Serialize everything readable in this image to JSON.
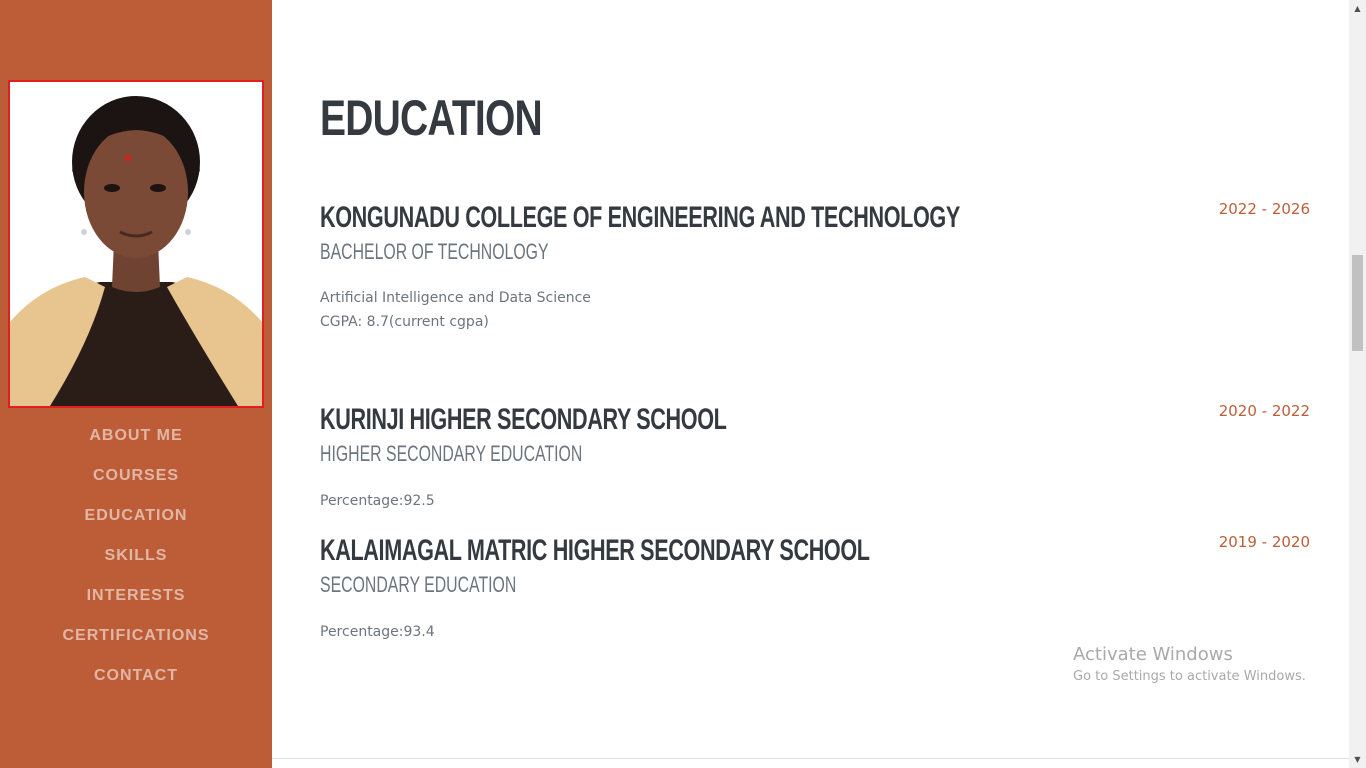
{
  "sidebar": {
    "nav": [
      {
        "label": "ABOUT ME"
      },
      {
        "label": "COURSES"
      },
      {
        "label": "EDUCATION"
      },
      {
        "label": "SKILLS"
      },
      {
        "label": "INTERESTS"
      },
      {
        "label": "CERTIFICATIONS"
      },
      {
        "label": "CONTACT"
      }
    ]
  },
  "section": {
    "title": "EDUCATION",
    "entries": [
      {
        "institution": "KONGUNADU COLLEGE OF ENGINEERING AND TECHNOLOGY",
        "degree": "BACHELOR OF TECHNOLOGY",
        "details": [
          "Artificial Intelligence and Data Science",
          "CGPA: 8.7(current cgpa)"
        ],
        "dates": "2022 - 2026"
      },
      {
        "institution": "KURINJI HIGHER SECONDARY SCHOOL",
        "degree": "HIGHER SECONDARY EDUCATION",
        "details": [
          "Percentage:92.5"
        ],
        "dates": "2020 - 2022"
      },
      {
        "institution": "KALAIMAGAL MATRIC HIGHER SECONDARY SCHOOL",
        "degree": "SECONDARY EDUCATION",
        "details": [
          "Percentage:93.4"
        ],
        "dates": "2019 - 2020"
      }
    ]
  },
  "watermark": {
    "title": "Activate Windows",
    "subtitle": "Go to Settings to activate Windows."
  },
  "colors": {
    "sidebar": "#bd5d38",
    "accent": "#bd5d38",
    "heading": "#343a40",
    "muted": "#6c757d"
  }
}
